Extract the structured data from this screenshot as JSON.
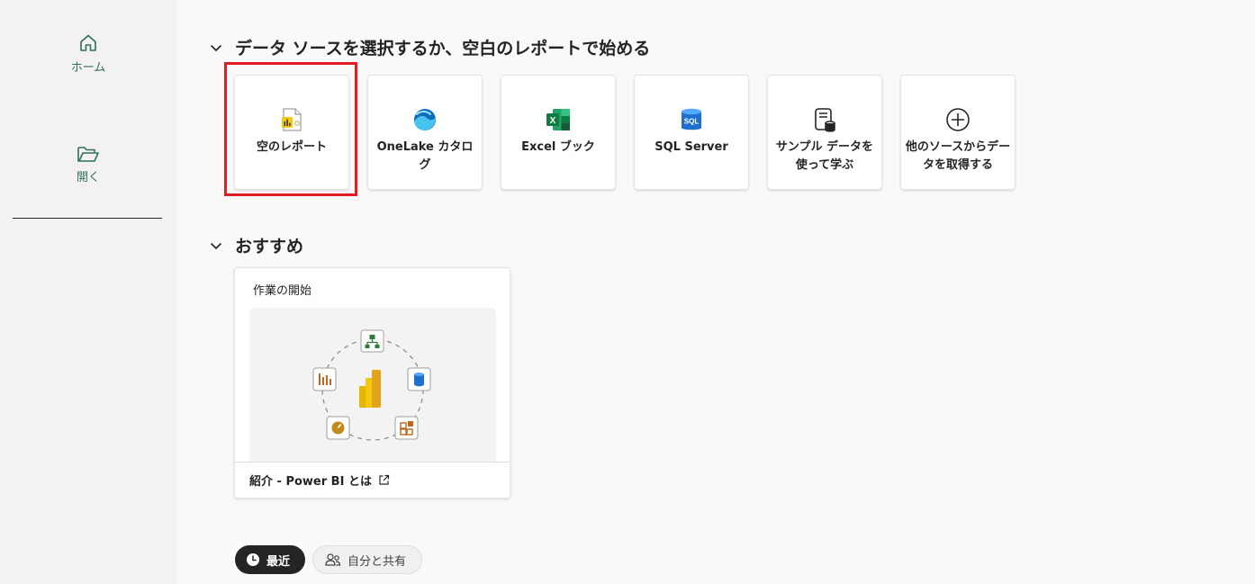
{
  "sidebar": {
    "items": [
      {
        "label": "ホーム",
        "icon": "home-icon"
      },
      {
        "label": "開く",
        "icon": "folder-open-icon"
      }
    ]
  },
  "sections": {
    "data_source": {
      "title": "データ ソースを選択するか、空白のレポートで始める",
      "cards": [
        {
          "label": "空のレポート",
          "icon": "blank-report-icon"
        },
        {
          "label": "OneLake カタログ",
          "icon": "onelake-icon"
        },
        {
          "label": "Excel ブック",
          "icon": "excel-icon"
        },
        {
          "label": "SQL Server",
          "icon": "sql-server-icon"
        },
        {
          "label": "サンプル データを使って学ぶ",
          "icon": "sample-data-icon"
        },
        {
          "label": "他のソースからデータを取得する",
          "icon": "add-circle-icon"
        }
      ]
    },
    "recommended": {
      "title": "おすすめ",
      "card": {
        "title": "作業の開始",
        "link": "紹介 - Power BI とは"
      }
    }
  },
  "tabs": {
    "recent": "最近",
    "shared": "自分と共有"
  },
  "colors": {
    "accent_green": "#2f6f5e",
    "highlight_red": "#e31b23",
    "powerbi_yellow": "#f2c811"
  }
}
